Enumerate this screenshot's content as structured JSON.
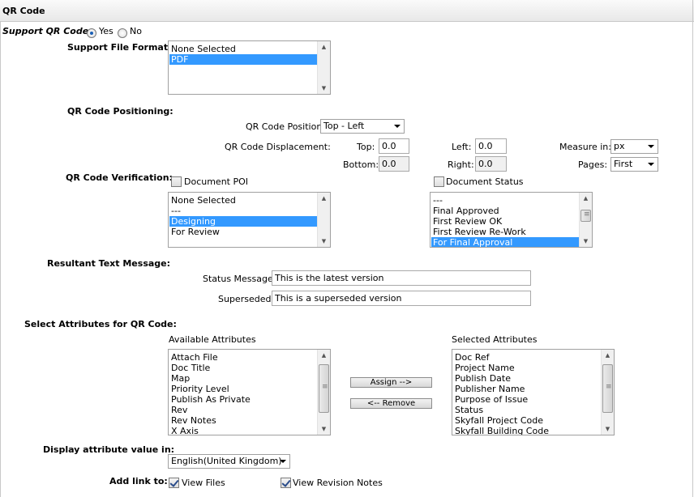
{
  "panel": {
    "title": "QR Code"
  },
  "support_qr": {
    "label": "Support QR Code:",
    "yes_label": "Yes",
    "no_label": "No",
    "selected": "Yes"
  },
  "file_format": {
    "label": "Support File Format:",
    "items": [
      {
        "text": "None Selected",
        "selected": false
      },
      {
        "text": "PDF",
        "selected": true
      }
    ]
  },
  "positioning": {
    "label": "QR Code Positioning:",
    "position_label": "QR Code Position:",
    "position_value": "Top - Left",
    "displacement_label": "QR Code Displacement:",
    "top_label": "Top:",
    "top_value": "0.0",
    "bottom_label": "Bottom:",
    "bottom_value": "0.0",
    "left_label": "Left:",
    "left_value": "0.0",
    "right_label": "Right:",
    "right_value": "0.0",
    "measure_label": "Measure in:",
    "measure_value": "px",
    "pages_label": "Pages:",
    "pages_value": "First"
  },
  "verification": {
    "label": "QR Code Verification:",
    "poi_label": "Document POI",
    "poi_checked": false,
    "poi_items": [
      {
        "text": "None Selected",
        "selected": false
      },
      {
        "text": "---",
        "selected": false
      },
      {
        "text": "Designing",
        "selected": true
      },
      {
        "text": "For Review",
        "selected": false
      }
    ],
    "status_label": "Document Status",
    "status_checked": false,
    "status_items": [
      {
        "text": "---",
        "selected": false
      },
      {
        "text": "Final Approved",
        "selected": false
      },
      {
        "text": "First Review OK",
        "selected": false
      },
      {
        "text": "First Review Re-Work",
        "selected": false
      },
      {
        "text": "For Final Approval",
        "selected": true
      }
    ]
  },
  "messages": {
    "label": "Resultant Text Message:",
    "status_label": "Status Message:",
    "status_value": "This is the latest version",
    "superseded_label": "Superseded:",
    "superseded_value": "This is a superseded version"
  },
  "attributes": {
    "label": "Select Attributes for QR Code:",
    "available_header": "Available Attributes",
    "available": [
      "Attach File",
      "Doc Title",
      "Map",
      "Priority Level",
      "Publish As Private",
      "Rev",
      "Rev Notes",
      "X Axis"
    ],
    "selected_header": "Selected Attributes",
    "selected": [
      "Doc Ref",
      "Project Name",
      "Publish Date",
      "Publisher Name",
      "Purpose of Issue",
      "Status",
      "Skyfall Project Code",
      "Skyfall Building Code"
    ],
    "assign_label": "Assign -->",
    "remove_label": "<-- Remove"
  },
  "display_value": {
    "label": "Display attribute value in:",
    "value": "English(United Kingdom)"
  },
  "add_link": {
    "label": "Add link to:",
    "view_files_label": "View Files",
    "view_files_checked": true,
    "view_revision_label": "View Revision Notes",
    "view_revision_checked": true
  }
}
